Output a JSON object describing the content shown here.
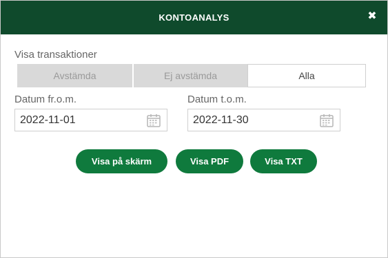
{
  "dialog": {
    "title": "KONTOANALYS",
    "close_glyph": "✖"
  },
  "filter": {
    "label": "Visa transaktioner",
    "options": [
      {
        "label": "Avstämda",
        "selected": false
      },
      {
        "label": "Ej avstämda",
        "selected": false
      },
      {
        "label": "Alla",
        "selected": true
      }
    ]
  },
  "date_from": {
    "label": "Datum fr.o.m.",
    "value": "2022-11-01"
  },
  "date_to": {
    "label": "Datum t.o.m.",
    "value": "2022-11-30"
  },
  "actions": {
    "show_screen": "Visa på skärm",
    "show_pdf": "Visa PDF",
    "show_txt": "Visa TXT"
  },
  "colors": {
    "header": "#0f4a2c",
    "primary_button": "#0f7a3d",
    "inactive_segment": "#d9d9d9"
  },
  "icons": {
    "close": "close-icon",
    "calendar": "calendar-icon"
  }
}
